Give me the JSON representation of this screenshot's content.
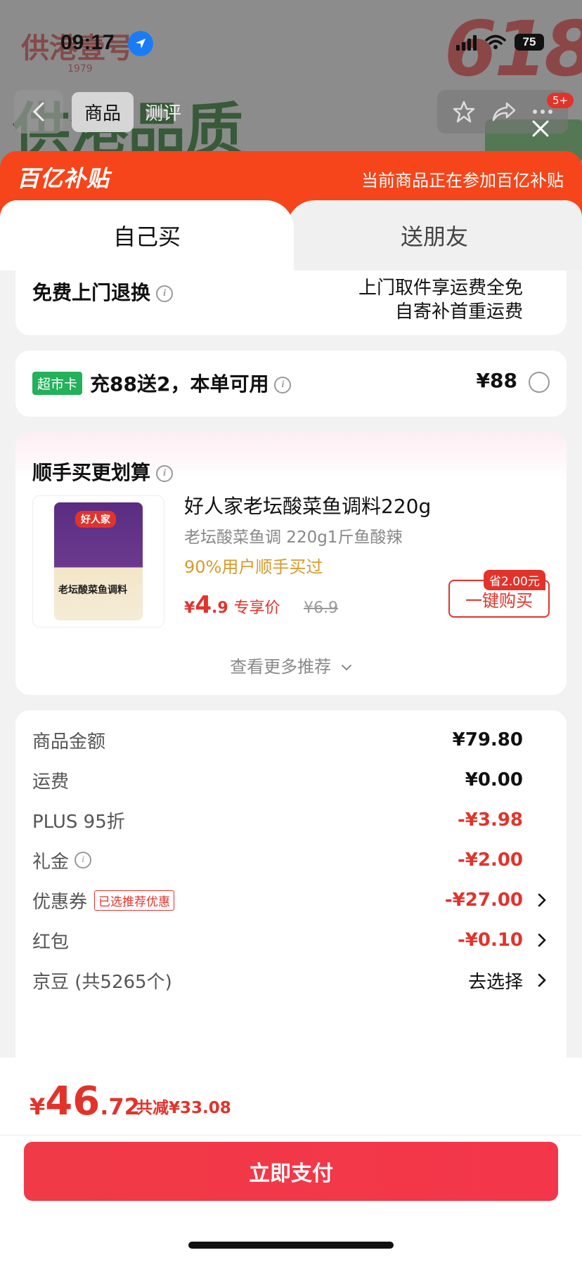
{
  "status_bar": {
    "time": "09:17",
    "battery": "75"
  },
  "background": {
    "brand": "供港壹号",
    "brand_year": "1979",
    "promo_618": "618",
    "quality_text": "供港品质",
    "nav": {
      "tab_goods": "商品",
      "tab_review": "测评",
      "badge": "5+"
    }
  },
  "subsidy": {
    "logo": "百亿补贴",
    "note": "当前商品正在参加百亿补贴"
  },
  "buy_tabs": {
    "self": "自己买",
    "friend": "送朋友"
  },
  "return_card": {
    "title": "免费上门退换",
    "info_line1": "上门取件享运费全免",
    "info_line2": "自寄补首重运费"
  },
  "market_card": {
    "tag": "超市卡",
    "text": "充88送2，本单可用",
    "price": "¥88"
  },
  "addon": {
    "title": "顺手买更划算",
    "product_name": "好人家老坛酸菜鱼调料220g",
    "spec": "老坛酸菜鱼调 220g1斤鱼酸辣",
    "users": "90%用户顺手买过",
    "price_yen": "¥",
    "price_int": "4",
    "price_dec": ".9",
    "price_label": "专享价",
    "orig_price": "¥6.9",
    "save_tag": "省2.00元",
    "oneclick": "一键购买",
    "more": "查看更多推荐",
    "pkg_logo": "好人家",
    "pkg_name": "老坛酸菜鱼调料"
  },
  "summary": [
    {
      "label": "商品金额",
      "value": "¥79.80"
    },
    {
      "label": "运费",
      "value": "¥0.00"
    },
    {
      "label": "PLUS 95折",
      "value": "-¥3.98"
    },
    {
      "label": "礼金",
      "value": "-¥2.00"
    },
    {
      "label": "优惠券",
      "tag": "已选推荐优惠",
      "value": "-¥27.00"
    },
    {
      "label": "红包",
      "value": "-¥0.10"
    },
    {
      "label": "京豆 (共5265个)",
      "value": "去选择"
    }
  ],
  "total": {
    "yen": "¥",
    "int": "46",
    "dec": ".72",
    "saved": "共减¥33.08"
  },
  "pay_button": "立即支付",
  "colors": {
    "accent": "#e2332b",
    "subsidy": "#f6451a",
    "tag_green": "#23b15a",
    "gold": "#d79a2b"
  }
}
